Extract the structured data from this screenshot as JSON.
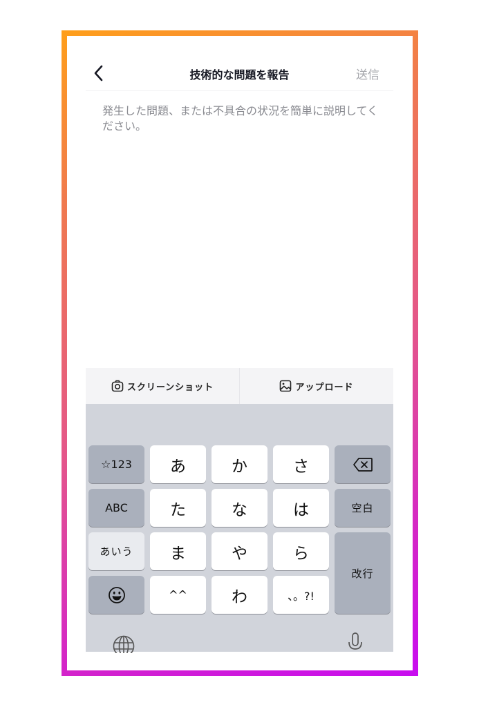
{
  "header": {
    "title": "技術的な問題を報告",
    "back_icon": "chevron-left-icon",
    "send_label": "送信"
  },
  "description": {
    "placeholder": "発生した問題、または不具合の状況を簡単に説明してください。",
    "value": ""
  },
  "attachments": {
    "screenshot_label": "スクリーンショット",
    "screenshot_icon": "camera-icon",
    "upload_label": "アップロード",
    "upload_icon": "image-icon"
  },
  "keyboard": {
    "rows": [
      [
        "☆123",
        "あ",
        "か",
        "さ",
        "delete"
      ],
      [
        "ABC",
        "た",
        "な",
        "は",
        "空白"
      ],
      [
        "あいう",
        "ま",
        "や",
        "ら",
        "改行"
      ],
      [
        "emoji",
        "^^",
        "わ",
        "、。?!"
      ]
    ],
    "symbols_key": "☆123",
    "abc_key": "ABC",
    "kana_key": "あいう",
    "space_key": "空白",
    "return_key": "改行",
    "keys": {
      "a": "あ",
      "ka": "か",
      "sa": "さ",
      "ta": "た",
      "na": "な",
      "ha": "は",
      "ma": "ま",
      "ya": "や",
      "ra": "ら",
      "kaomoji": "^^",
      "wa": "わ",
      "punct": "、。?!"
    },
    "globe_icon": "globe-icon",
    "mic_icon": "microphone-icon",
    "emoji_icon": "emoji-icon",
    "delete_icon": "delete-icon"
  },
  "colors": {
    "frame_start": "#ff9f1a",
    "frame_end": "#c80cf0",
    "keyboard_bg": "#d1d4db",
    "function_key": "#aab0bc"
  }
}
